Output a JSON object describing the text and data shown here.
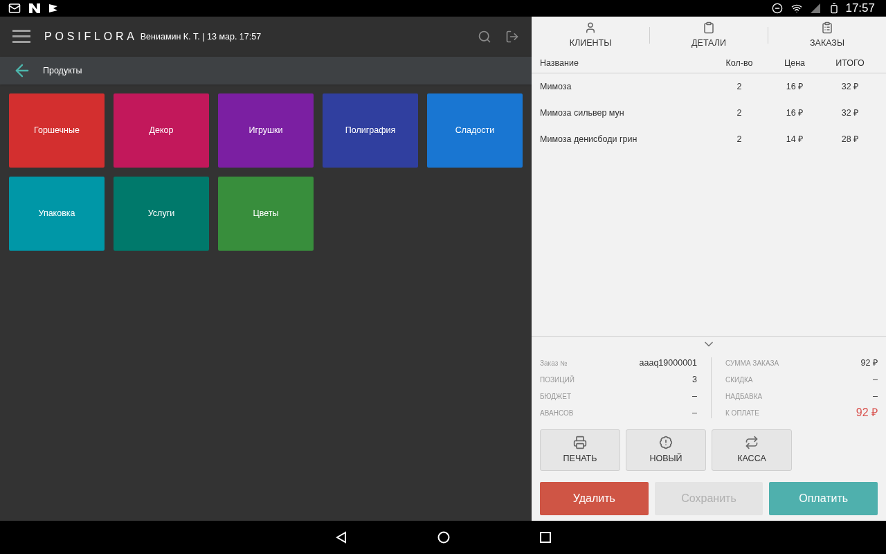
{
  "status_bar": {
    "time": "17:57"
  },
  "header": {
    "logo": "POSIFLORA",
    "user_info": "Вениамин К. Т. | 13 мар. 17:57"
  },
  "breadcrumb": {
    "title": "Продукты"
  },
  "categories": [
    {
      "label": "Горшечные",
      "color": "#d32f2f"
    },
    {
      "label": "Декор",
      "color": "#c2185b"
    },
    {
      "label": "Игрушки",
      "color": "#7b1fa2"
    },
    {
      "label": "Полиграфия",
      "color": "#303f9f"
    },
    {
      "label": "Сладости",
      "color": "#1976d2"
    },
    {
      "label": "Упаковка",
      "color": "#0097a7"
    },
    {
      "label": "Услуги",
      "color": "#00796b"
    },
    {
      "label": "Цветы",
      "color": "#388e3c"
    }
  ],
  "tabs": [
    {
      "label": "КЛИЕНТЫ",
      "kind": "person"
    },
    {
      "label": "ДЕТАЛИ",
      "kind": "clipboard"
    },
    {
      "label": "ЗАКАЗЫ",
      "kind": "list"
    }
  ],
  "table": {
    "columns": [
      "Название",
      "Кол-во",
      "Цена",
      "ИТОГО"
    ],
    "rows": [
      [
        "Мимоза",
        "2",
        "16 ₽",
        "32 ₽"
      ],
      [
        "Мимоза сильвер мун",
        "2",
        "16 ₽",
        "32 ₽"
      ],
      [
        "Мимоза денисбоди грин",
        "2",
        "14 ₽",
        "28 ₽"
      ]
    ]
  },
  "summary_left": [
    {
      "label": "Заказ №",
      "value": "aaaq19000001"
    },
    {
      "label": "ПОЗИЦИЙ",
      "value": "3"
    },
    {
      "label": "БЮДЖЕТ",
      "value": "–"
    },
    {
      "label": "АВАНСОВ",
      "value": "–"
    }
  ],
  "summary_right": [
    {
      "label": "СУММА ЗАКАЗА",
      "value": "92 ₽",
      "highlight": false
    },
    {
      "label": "СКИДКА",
      "value": "–",
      "highlight": false
    },
    {
      "label": "НАДБАВКА",
      "value": "–",
      "highlight": false
    },
    {
      "label": "К ОПЛАТЕ",
      "value": "92 ₽",
      "highlight": true
    }
  ],
  "tool_buttons": [
    {
      "label": "ПЕЧАТЬ",
      "kind": "print"
    },
    {
      "label": "НОВЫЙ",
      "kind": "new"
    },
    {
      "label": "КАССА",
      "kind": "register"
    }
  ],
  "action_buttons": [
    {
      "label": "Удалить",
      "kind": "delete",
      "disabled": false
    },
    {
      "label": "Сохранить",
      "kind": "save",
      "disabled": true
    },
    {
      "label": "Оплатить",
      "kind": "pay",
      "disabled": false
    }
  ]
}
